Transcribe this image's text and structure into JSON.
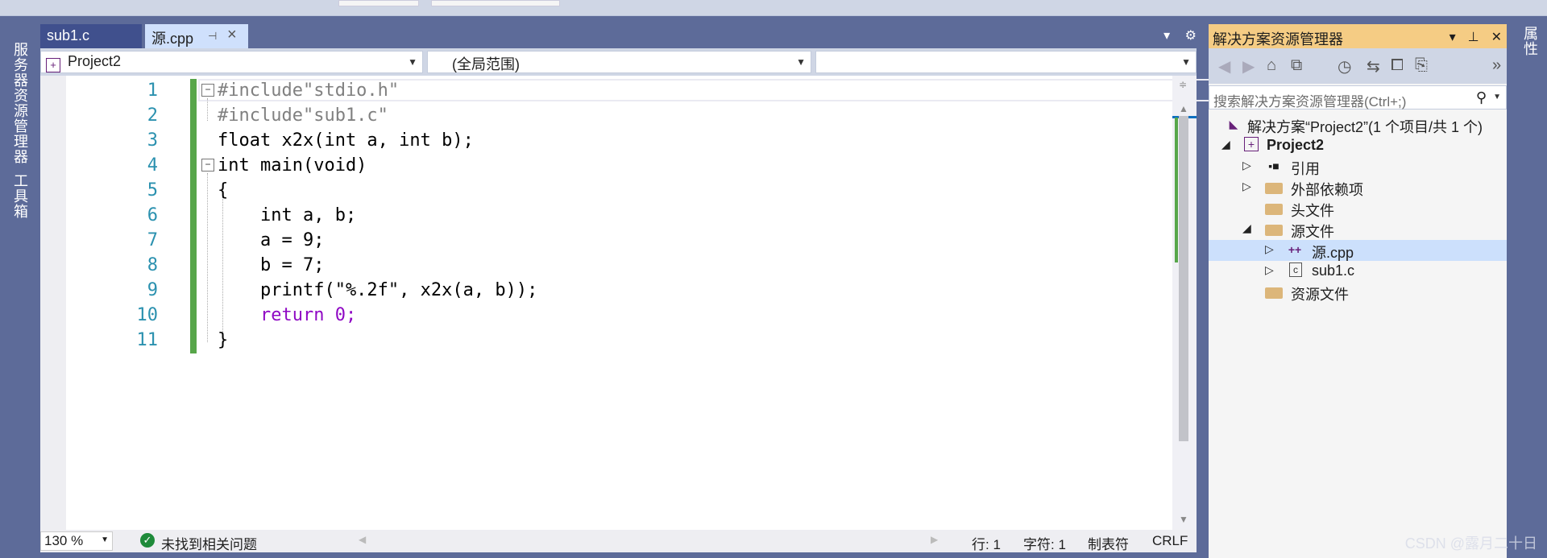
{
  "left_strip": {
    "server_explorer": "服务器资源管理器",
    "toolbox": "工具箱"
  },
  "right_strip": {
    "properties": "属性"
  },
  "doc_tabs": [
    {
      "label": "sub1.c",
      "active": false
    },
    {
      "label": "源.cpp",
      "active": true
    }
  ],
  "navbar": {
    "project": "Project2",
    "scope": "(全局范围)",
    "member": ""
  },
  "editor": {
    "line_numbers": [
      "1",
      "2",
      "3",
      "4",
      "5",
      "6",
      "7",
      "8",
      "9",
      "10",
      "11"
    ],
    "lines": [
      "#include\"stdio.h\"",
      "#include\"sub1.c\"",
      "float x2x(int a, int b);",
      "int main(void)",
      "{",
      "    int a, b;",
      "    a = 9;",
      "    b = 7;",
      "    printf(\"%.2f\", x2x(a, b));",
      "    return 0;",
      "}"
    ]
  },
  "status": {
    "zoom": "130 %",
    "issues": "未找到相关问题",
    "line": "行: 1",
    "char": "字符: 1",
    "indent": "制表符",
    "eol": "CRLF"
  },
  "solution_explorer": {
    "title": "解决方案资源管理器",
    "search_placeholder": "搜索解决方案资源管理器(Ctrl+;)",
    "tree": [
      {
        "label": "解决方案“Project2”(1 个项目/共 1 个)",
        "icon": "solution-icon",
        "depth": 0,
        "expander": ""
      },
      {
        "label": "Project2",
        "icon": "project-icon",
        "depth": 1,
        "expander": "◢",
        "bold": true
      },
      {
        "label": "引用",
        "icon": "references-icon",
        "depth": 2,
        "expander": "▷"
      },
      {
        "label": "外部依赖项",
        "icon": "external-deps-icon",
        "depth": 2,
        "expander": "▷"
      },
      {
        "label": "头文件",
        "icon": "folder-icon",
        "depth": 2,
        "expander": ""
      },
      {
        "label": "源文件",
        "icon": "folder-icon",
        "depth": 2,
        "expander": "◢"
      },
      {
        "label": "源.cpp",
        "icon": "cpp-file-icon",
        "depth": 3,
        "expander": "▷",
        "selected": true
      },
      {
        "label": "sub1.c",
        "icon": "c-file-icon",
        "depth": 3,
        "expander": "▷"
      },
      {
        "label": "资源文件",
        "icon": "folder-icon",
        "depth": 2,
        "expander": ""
      }
    ]
  },
  "watermark": "CSDN @露月二十日",
  "colors": {
    "frame": "#5d6b99",
    "active_tab": "#cfe0fc",
    "panel_title": "#f5cc84",
    "selection": "#cce0fc",
    "change_bar": "#57a64a",
    "line_number": "#2b91af"
  }
}
